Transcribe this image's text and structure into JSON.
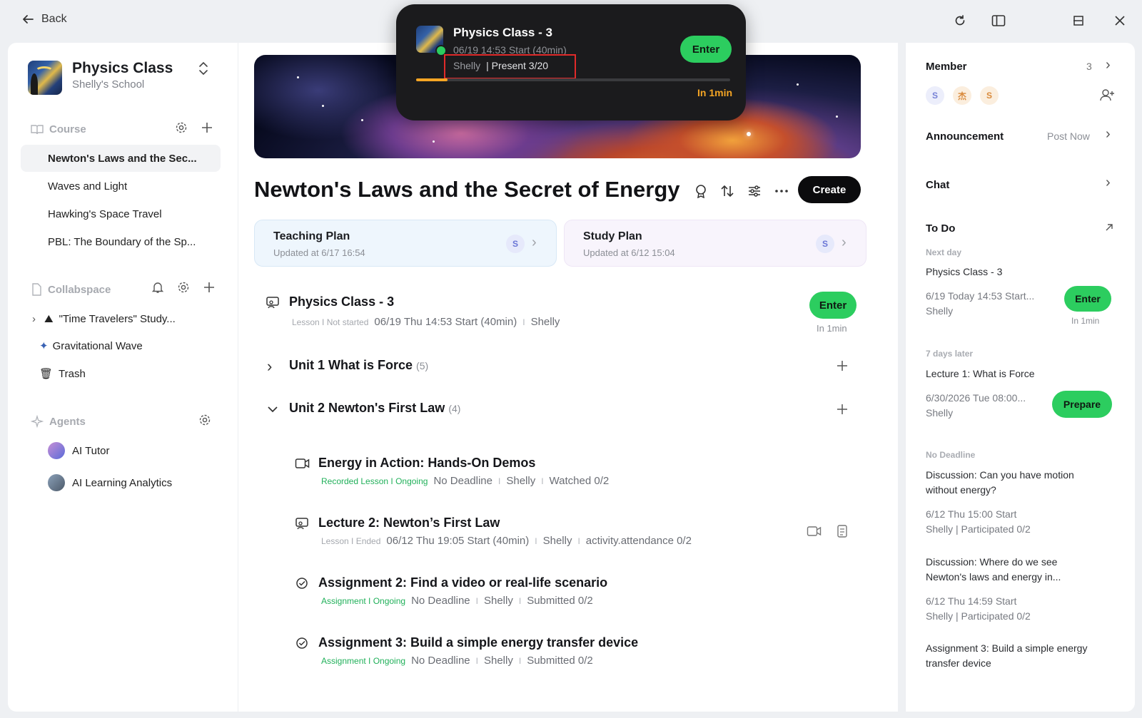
{
  "titlebar": {
    "back_label": "Back"
  },
  "popup": {
    "title": "Physics Class - 3",
    "time": "06/19 14:53 Start (40min)",
    "teacher": "Shelly",
    "present": "| Present 3/20",
    "enter_label": "Enter",
    "countdown": "In 1min",
    "progress": 0.1
  },
  "sidebar": {
    "class_title": "Physics Class",
    "school": "Shelly's School",
    "course_header": "Course",
    "courses": [
      "Newton's Laws and the Sec...",
      "Waves and Light",
      "Hawking's Space Travel",
      "PBL: The Boundary of the Sp..."
    ],
    "collab_header": "Collabspace",
    "collab_items": [
      "\"Time Travelers\" Study...",
      "Gravitational Wave",
      "Trash"
    ],
    "agents_header": "Agents",
    "agents": [
      "AI Tutor",
      "AI Learning Analytics"
    ]
  },
  "main": {
    "title": "Newton's Laws and the Secret of Energy",
    "create_label": "Create",
    "teaching_plan": {
      "title": "Teaching Plan",
      "updated": "Updated at 6/17 16:54",
      "avatar": "S"
    },
    "study_plan": {
      "title": "Study Plan",
      "updated": "Updated at 6/12 15:04",
      "avatar": "S"
    },
    "live": {
      "title": "Physics Class - 3",
      "tag": "Lesson I Not started",
      "time": "06/19 Thu 14:53 Start (40min)",
      "teacher": "Shelly",
      "enter_label": "Enter",
      "countdown": "In 1min"
    },
    "unit1": {
      "title": "Unit 1 What is Force",
      "count": "(5)"
    },
    "unit2": {
      "title": "Unit 2 Newton's First Law",
      "count": "(4)"
    },
    "items": [
      {
        "title": "Energy in Action: Hands-On Demos",
        "tag": "Recorded Lesson I Ongoing",
        "deadline": "No Deadline",
        "teacher": "Shelly",
        "stat": "Watched  0/2"
      },
      {
        "title": "Lecture 2: Newton’s First Law",
        "tag": "Lesson I Ended",
        "deadline": "06/12 Thu 19:05 Start (40min)",
        "teacher": "Shelly",
        "stat": "activity.attendance  0/2"
      },
      {
        "title": "Assignment 2: Find a video or real-life scenario",
        "tag": "Assignment I Ongoing",
        "deadline": "No Deadline",
        "teacher": "Shelly",
        "stat": "Submitted  0/2"
      },
      {
        "title": "Assignment 3: Build a simple energy transfer device",
        "tag": "Assignment I Ongoing",
        "deadline": "No Deadline",
        "teacher": "Shelly",
        "stat": "Submitted  0/2"
      }
    ]
  },
  "right": {
    "member_header": "Member",
    "member_count": "3",
    "member_avatars": [
      "S",
      "杰",
      "S"
    ],
    "announcement_header": "Announcement",
    "post_now": "Post Now",
    "chat_header": "Chat",
    "todo_header": "To Do",
    "next_day_label": "Next day",
    "todo1": {
      "title": "Physics Class - 3",
      "time": "6/19 Today 14:53 Start...",
      "teacher": "Shelly",
      "btn": "Enter",
      "countdown": "In 1min"
    },
    "later_label": "7 days later",
    "todo2": {
      "title": "Lecture 1: What is Force",
      "time": "6/30/2026 Tue 08:00...",
      "teacher": "Shelly",
      "btn": "Prepare"
    },
    "no_deadline_label": "No Deadline",
    "todo3": {
      "title1": "Discussion: Can you have motion",
      "title2": "without energy?",
      "time": "6/12 Thu 15:00 Start",
      "meta": "Shelly | Participated 0/2"
    },
    "todo4": {
      "title1": "Discussion: Where do we see",
      "title2": "Newton's laws and energy in...",
      "time": "6/12 Thu 14:59 Start",
      "meta": "Shelly | Participated 0/2"
    },
    "todo5": {
      "title1": "Assignment 3: Build a simple energy",
      "title2": "transfer device"
    }
  },
  "colors": {
    "accent_green": "#2ccd5f",
    "dark": "#0b0b0d",
    "teaching_bg": "#eef6fd",
    "study_bg": "#f8f4fc"
  }
}
